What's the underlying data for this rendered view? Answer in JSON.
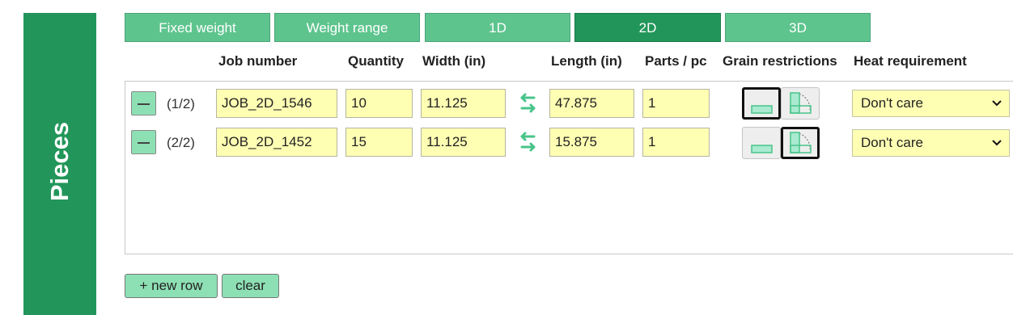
{
  "sidebar": {
    "title": "Pieces"
  },
  "tabs": [
    {
      "label": "Fixed weight",
      "active": false
    },
    {
      "label": "Weight range",
      "active": false
    },
    {
      "label": "1D",
      "active": false
    },
    {
      "label": "2D",
      "active": true
    },
    {
      "label": "3D",
      "active": false
    }
  ],
  "columns": {
    "job_number": "Job number",
    "quantity": "Quantity",
    "width": "Width (in)",
    "length": "Length (in)",
    "parts_per_pc": "Parts / pc",
    "grain": "Grain restrictions",
    "heat": "Heat requirement"
  },
  "rows": [
    {
      "index": "(1/2)",
      "job": "JOB_2D_1546",
      "quantity": "10",
      "width": "11.125",
      "length": "47.875",
      "parts": "1",
      "grain_selected": "fixed",
      "heat": "Don't care"
    },
    {
      "index": "(2/2)",
      "job": "JOB_2D_1452",
      "quantity": "15",
      "width": "11.125",
      "length": "15.875",
      "parts": "1",
      "grain_selected": "rotatable",
      "heat": "Don't care"
    }
  ],
  "actions": {
    "new_row": "+ new row",
    "clear": "clear"
  },
  "colors": {
    "accent": "#22965a",
    "tab": "#5ec48e",
    "button": "#8de0b4",
    "input_bg": "#ffffb4"
  }
}
